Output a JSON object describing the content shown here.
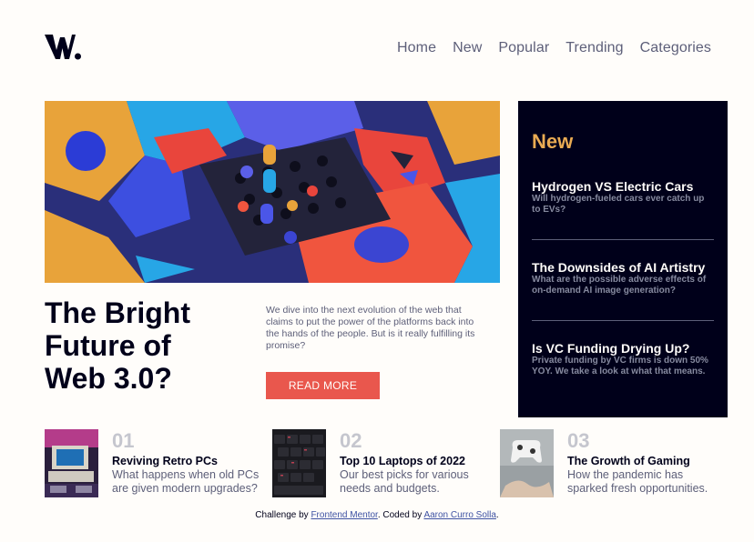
{
  "logo": {
    "icon": "logo-w-icon"
  },
  "nav": {
    "items": [
      {
        "label": "Home"
      },
      {
        "label": "New"
      },
      {
        "label": "Popular"
      },
      {
        "label": "Trending"
      },
      {
        "label": "Categories"
      }
    ]
  },
  "hero": {
    "headline_line1": "The Bright",
    "headline_line2": "Future of",
    "headline_line3": "Web 3.0?",
    "intro": "We dive into the next evolution of the web that claims to put the power of the platforms back into the hands of the people. But is it really fulfilling its promise?",
    "button_label": "READ MORE"
  },
  "new_panel": {
    "title": "New",
    "items": [
      {
        "title": "Hydrogen VS Electric Cars",
        "desc": "Will hydrogen-fueled cars ever catch up to EVs?"
      },
      {
        "title": "The Downsides of AI Artistry",
        "desc": "What are the possible adverse effects of on-demand AI image generation?"
      },
      {
        "title": "Is VC Funding Drying Up?",
        "desc": "Private funding by VC firms is down 50% YOY. We take a look at what that means."
      }
    ]
  },
  "cards": [
    {
      "num": "01",
      "title": "Reviving Retro PCs",
      "desc": "What happens when old PCs are given modern upgrades?"
    },
    {
      "num": "02",
      "title": "Top 10 Laptops of 2022",
      "desc": "Our best picks for various needs and budgets."
    },
    {
      "num": "03",
      "title": "The Growth of Gaming",
      "desc": "How the pandemic has sparked fresh opportunities."
    }
  ],
  "footer": {
    "prefix": "Challenge by",
    "link1": "Frontend Mentor",
    "middle": ". Coded by",
    "link2": "Aaron Curro Solla",
    "suffix": "."
  },
  "colors": {
    "accent_red": "#e9574d",
    "accent_orange": "#e9ab53",
    "dark_navy": "#00001a",
    "grayish_blue": "#5d5f79",
    "off_white": "#fffdfa"
  }
}
